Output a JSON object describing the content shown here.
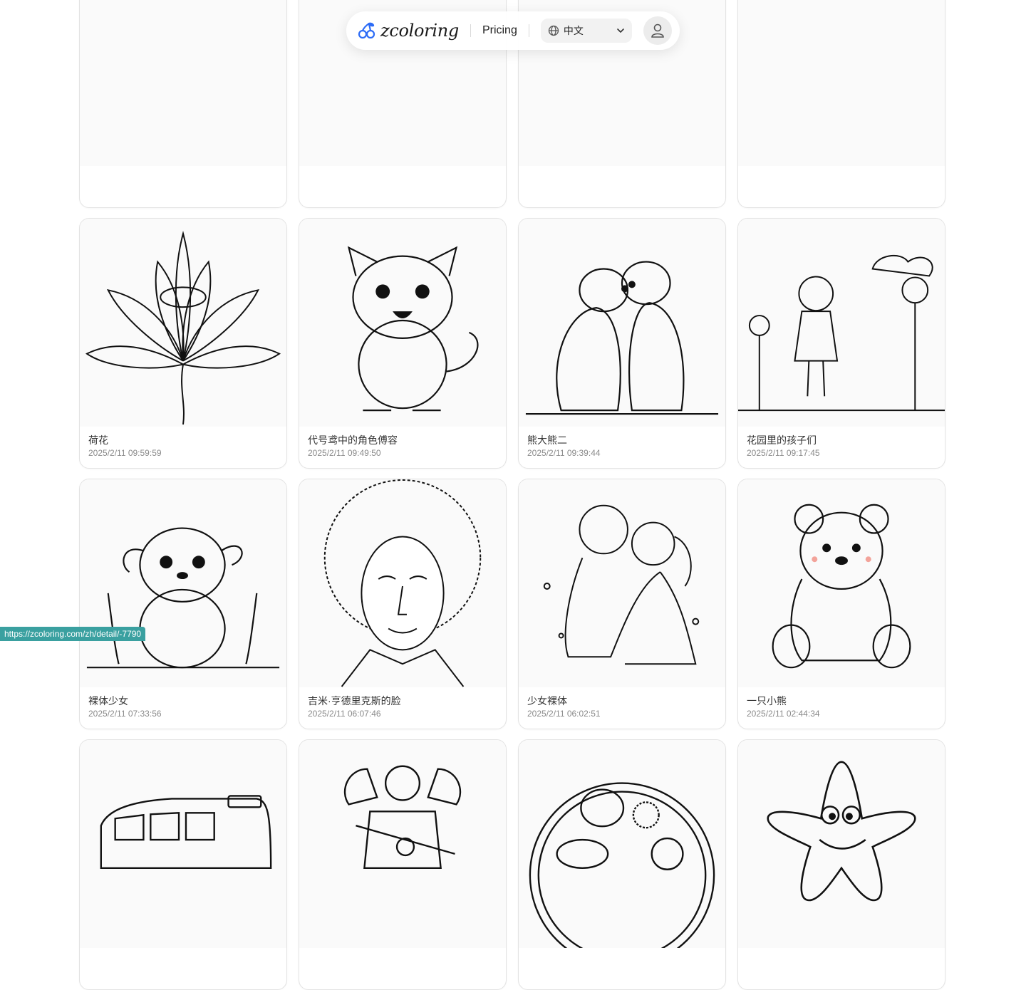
{
  "nav": {
    "brand": "zcoloring",
    "pricing_label": "Pricing",
    "language": "中文",
    "accent_color": "#2d6cf6"
  },
  "gallery": {
    "items": [
      {
        "title": "",
        "date": "",
        "image": "partial-card"
      },
      {
        "title": "",
        "date": "",
        "image": "partial-card"
      },
      {
        "title": "",
        "date": "",
        "image": "partial-card"
      },
      {
        "title": "",
        "date": "",
        "image": "partial-card"
      },
      {
        "title": "荷花",
        "date": "2025/2/11 09:59:59",
        "image": "lotus"
      },
      {
        "title": "代号鸢中的角色傅容",
        "date": "2025/2/11 09:49:50",
        "image": "cat"
      },
      {
        "title": "熊大熊二",
        "date": "2025/2/11 09:39:44",
        "image": "two-bears"
      },
      {
        "title": "花园里的孩子们",
        "date": "2025/2/11 09:17:45",
        "image": "girl-garden"
      },
      {
        "title": "裸体少女",
        "date": "2025/2/11 07:33:56",
        "image": "puppy"
      },
      {
        "title": "吉米·亨德里克斯的脸",
        "date": "2025/2/11 06:07:46",
        "image": "face-afro"
      },
      {
        "title": "少女裸体",
        "date": "2025/2/11 06:02:51",
        "image": "hugging-kids"
      },
      {
        "title": "一只小熊",
        "date": "2025/2/11 02:44:34",
        "image": "bear-cub"
      },
      {
        "title": "",
        "date": "",
        "image": "bus"
      },
      {
        "title": "",
        "date": "",
        "image": "space-marine"
      },
      {
        "title": "",
        "date": "",
        "image": "pizza"
      },
      {
        "title": "",
        "date": "",
        "image": "starfish"
      }
    ]
  },
  "status_bar": {
    "url": "https://zcoloring.com/zh/detail/-7790"
  }
}
